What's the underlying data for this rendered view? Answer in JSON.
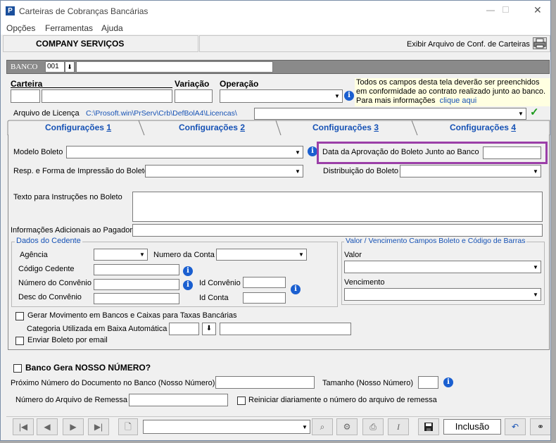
{
  "window": {
    "title": "Carteiras de Cobranças Bancárias",
    "app_icon": "P",
    "min": "—",
    "max": "☐",
    "close": "✕"
  },
  "menu": [
    "Opções",
    "Ferramentas",
    "Ajuda"
  ],
  "header": {
    "company": "COMPANY SERVIÇOS",
    "exibir_label": "Exibir Arquivo de Conf. de Carteiras"
  },
  "banco": {
    "label": "BANCO",
    "code": "001"
  },
  "fields": {
    "carteira": "Carteira",
    "variacao": "Variação",
    "operacao": "Operação",
    "info_text": "Todos os campos desta tela deverão ser preenchidos em conformidade ao contrato realizado junto ao banco. Para mais informações",
    "info_link": "clique aqui",
    "arquivo_licenca": "Arquivo de Licença",
    "licenca_path": "C:\\Prosoft.win\\PrServ\\Crb\\DefBolA4\\Licencas\\"
  },
  "tabs": [
    {
      "prefix": "Configurações ",
      "num": "1"
    },
    {
      "prefix": "Configurações ",
      "num": "2"
    },
    {
      "prefix": "Configurações ",
      "num": "3"
    },
    {
      "prefix": "Configurações ",
      "num": "4"
    }
  ],
  "config": {
    "modelo_boleto": "Modelo Boleto",
    "data_aprovacao": "Data da Aprovação do Boleto Junto ao Banco",
    "resp_forma": "Resp. e Forma de Impressão do Boleto",
    "distribuicao": "Distribuição do Boleto",
    "texto_instrucoes": "Texto para Instruções no Boleto",
    "info_adicionais": "Informações Adicionais ao Pagador"
  },
  "cedente": {
    "legend": "Dados do Cedente",
    "agencia": "Agência",
    "numero_conta": "Numero da Conta",
    "codigo_cedente": "Código Cedente",
    "numero_convenio": "Número do Convênio",
    "id_convenio": "Id Convênio",
    "desc_convenio": "Desc do Convênio",
    "id_conta": "Id Conta"
  },
  "valor_venc": {
    "legend": "Valor / Vencimento Campos Boleto e Código de Barras",
    "valor": "Valor",
    "vencimento": "Vencimento"
  },
  "movimento": {
    "gerar": "Gerar Movimento em Bancos e Caixas  para Taxas Bancárias",
    "categoria": "Categoria Utilizada em Baixa Automática",
    "enviar_email": "Enviar Boleto por email"
  },
  "nosso_numero": {
    "banco_gera": "Banco Gera NOSSO NÚMERO?",
    "proximo": "Próximo Número do Documento no Banco (Nosso Número)",
    "tamanho": "Tamanho (Nosso Número)",
    "arquivo_remessa": "Número do Arquivo de Remessa",
    "reiniciar": "Reiniciar diariamente o número do arquivo de remessa"
  },
  "toolbar": {
    "mode": "Inclusão"
  },
  "colors": {
    "accent_purple": "#9b3fa8",
    "link_blue": "#1652b5",
    "banco_bar": "#8a8a8a"
  }
}
